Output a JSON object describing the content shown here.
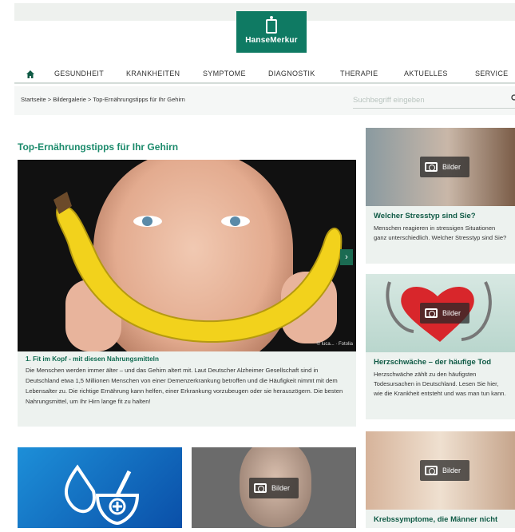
{
  "brand": {
    "name": "HanseMerkur",
    "color": "#0f7a63",
    "accent": "#1b8a6b"
  },
  "nav": {
    "home_icon": "home-icon",
    "items": [
      "GESUNDHEIT",
      "KRANKHEITEN",
      "SYMPTOME",
      "DIAGNOSTIK",
      "THERAPIE",
      "AKTUELLES",
      "SERVICE"
    ]
  },
  "breadcrumb": "Startseite > Bildergalerie > Top-Ernährungstipps für Ihr Gehirn",
  "search": {
    "placeholder": "Suchbegriff eingeben",
    "icon": "search-icon"
  },
  "page_title": "Top-Ernährungstipps für Ihr Gehirn",
  "hero": {
    "image_credit": "© luca... · Fotolia",
    "next_icon": "chevron-right-icon",
    "next_label": "›",
    "caption_title": "1. Fit im Kopf - mit diesen Nahrungsmitteln",
    "caption_text": "Die Menschen werden immer älter – und das Gehirn altert mit. Laut Deutscher Alzheimer Gesellschaft sind in Deutschland etwa 1,5 Millionen Menschen von einer Demenzerkrankung betroffen und die Häufigkeit nimmt mit dem Lebensalter zu. Die richtige Ernährung kann helfen, einer Erkrankung vorzubeugen oder sie herauszögern. Die besten Nahrungsmittel, um Ihr Hirn lange fit zu halten!"
  },
  "sidebar_cards": [
    {
      "badge": "Bilder",
      "title": "Welcher Stresstyp sind Sie?",
      "text": "Menschen reagieren in stressigen Situationen ganz unterschiedlich. Welcher Stresstyp sind Sie?"
    },
    {
      "badge": "Bilder",
      "title": "Herzschwäche – der häufige Tod",
      "text": "Herzschwäche zählt zu den häufigsten Todesursachen in Deutschland. Lesen Sie hier, wie die Krankheit entsteht und was man tun kann."
    },
    {
      "badge": "Bilder",
      "title": "Krebssymptome, die Männer nicht"
    }
  ],
  "bottom_cards": [
    {
      "badge": ""
    },
    {
      "badge": "Bilder"
    }
  ]
}
